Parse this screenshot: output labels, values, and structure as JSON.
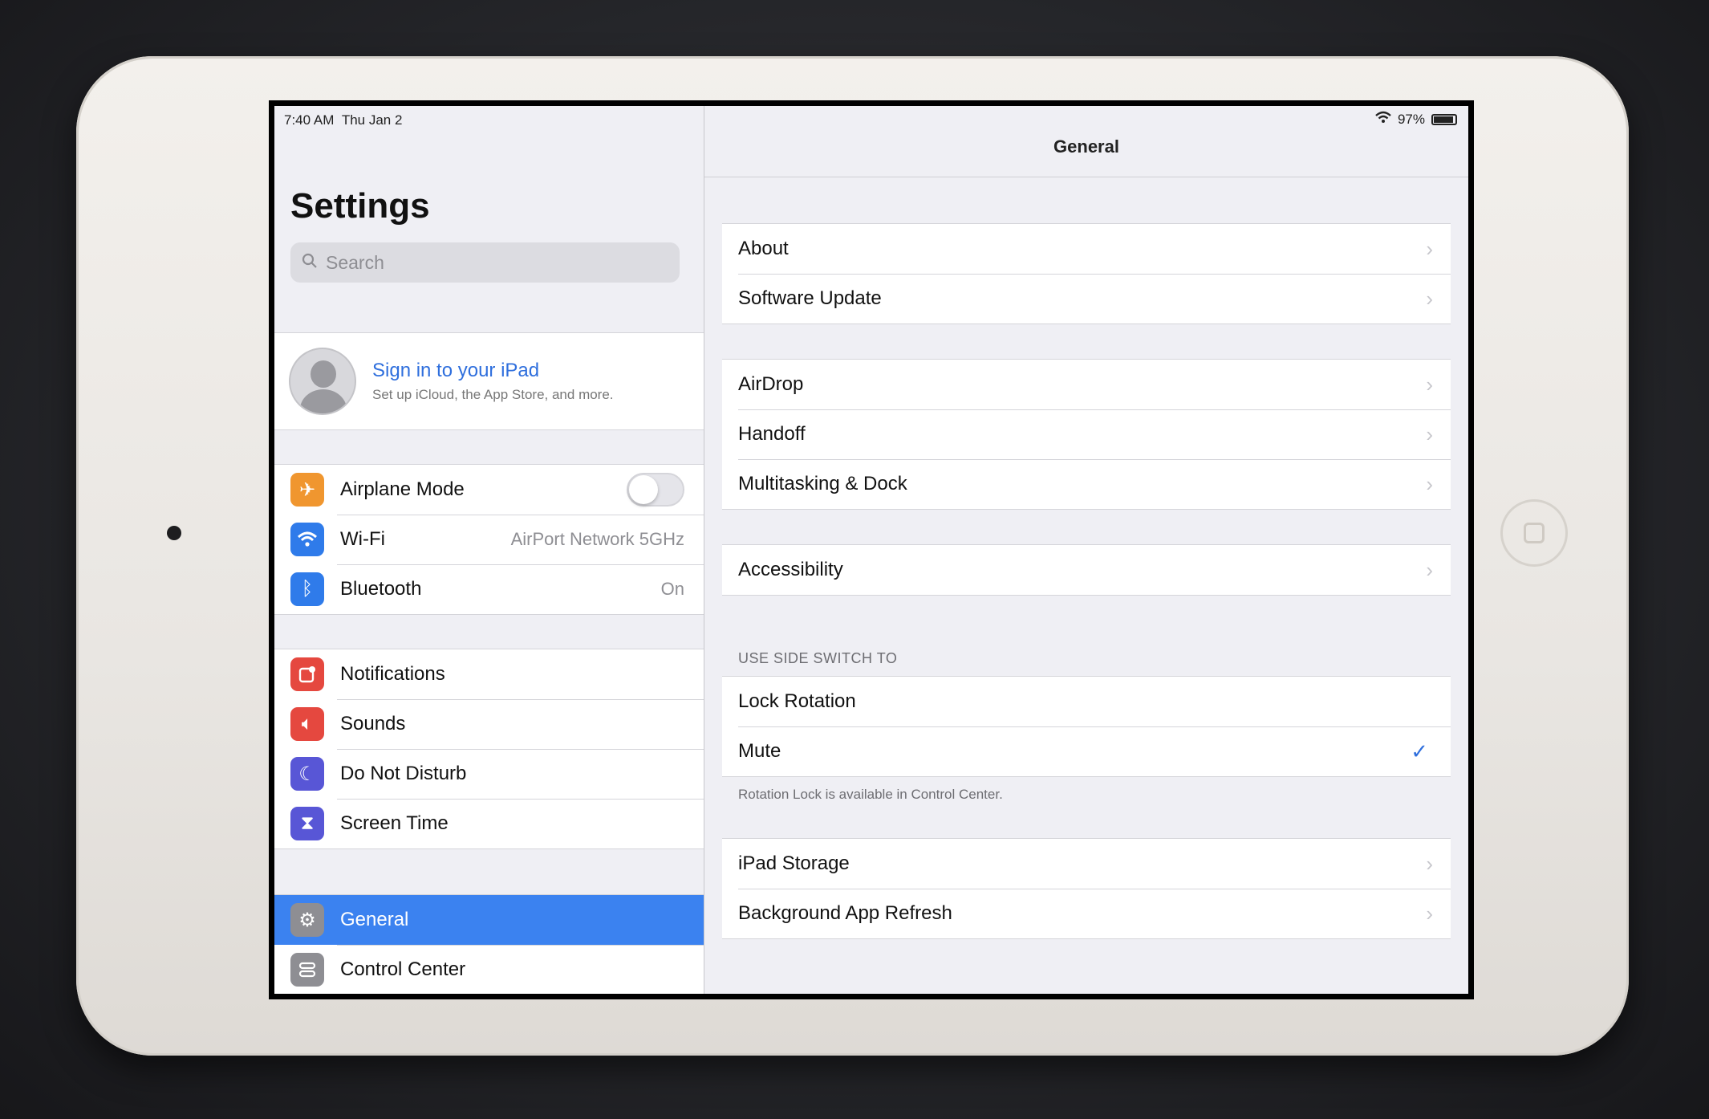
{
  "status": {
    "time": "7:40 AM",
    "date": "Thu Jan 2",
    "battery": "97%",
    "battery_level": 0.97
  },
  "sidebar": {
    "title": "Settings",
    "search_placeholder": "Search",
    "profile": {
      "title": "Sign in to your iPad",
      "subtitle": "Set up iCloud, the App Store, and more."
    },
    "group1": [
      {
        "label": "Airplane Mode",
        "icon": "airplane-icon",
        "color": "#f0962f",
        "toggle": false
      },
      {
        "label": "Wi-Fi",
        "icon": "wifi-icon",
        "color": "#2f7bea",
        "value": "AirPort Network 5GHz"
      },
      {
        "label": "Bluetooth",
        "icon": "bluetooth-icon",
        "color": "#2f7bea",
        "value": "On"
      }
    ],
    "group2": [
      {
        "label": "Notifications",
        "icon": "notifications-icon",
        "color": "#e5483f"
      },
      {
        "label": "Sounds",
        "icon": "sounds-icon",
        "color": "#e5483f"
      },
      {
        "label": "Do Not Disturb",
        "icon": "moon-icon",
        "color": "#5856d6"
      },
      {
        "label": "Screen Time",
        "icon": "hourglass-icon",
        "color": "#5856d6"
      }
    ],
    "group3": [
      {
        "label": "General",
        "icon": "gear-icon",
        "color": "#8e8e93",
        "selected": true
      },
      {
        "label": "Control Center",
        "icon": "control-center-icon",
        "color": "#8e8e93"
      }
    ],
    "selected_color": "#3b82f0"
  },
  "detail": {
    "title": "General",
    "group1": [
      {
        "label": "About"
      },
      {
        "label": "Software Update"
      }
    ],
    "group2": [
      {
        "label": "AirDrop"
      },
      {
        "label": "Handoff"
      },
      {
        "label": "Multitasking & Dock"
      }
    ],
    "group3": [
      {
        "label": "Accessibility"
      }
    ],
    "side_switch_header": "USE SIDE SWITCH TO",
    "side_switch": [
      {
        "label": "Lock Rotation"
      },
      {
        "label": "Mute",
        "checked": true
      }
    ],
    "side_switch_footer": "Rotation Lock is available in Control Center.",
    "group4": [
      {
        "label": "iPad Storage"
      },
      {
        "label": "Background App Refresh"
      }
    ]
  }
}
